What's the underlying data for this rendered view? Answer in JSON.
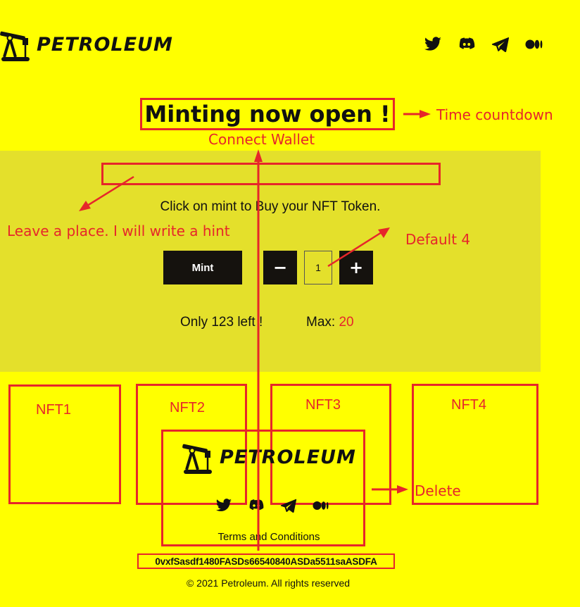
{
  "brand": {
    "name": "PETROLEUM"
  },
  "header": {
    "social_icons": [
      "twitter-icon",
      "discord-icon",
      "telegram-icon",
      "medium-icon"
    ]
  },
  "hero": {
    "title": "Minting now open !"
  },
  "annotations": {
    "time_countdown": "Time countdown",
    "connect_wallet": "Connect Wallet",
    "hint_note": "Leave a place. I will write a hint",
    "default_note": "Default 4",
    "delete_note": "Delete"
  },
  "mint_panel": {
    "instruction": "Click on mint to Buy your NFT Token.",
    "mint_label": "Mint",
    "decrement_label": "−",
    "increment_label": "+",
    "quantity": "1",
    "remaining": "Only 123 left !",
    "max_label": "Max:",
    "max_value": "20"
  },
  "nfts": [
    "NFT1",
    "NFT2",
    "NFT3",
    "NFT4"
  ],
  "footer": {
    "terms": "Terms and Conditions",
    "wallet_address": "0vxfSasdf1480FASDs66540840ASDa5511saASDFA",
    "copyright": "© 2021 Petroleum. All rights reserved"
  },
  "colors": {
    "background": "#ffff00",
    "panel": "#e4e02b",
    "annotation": "#e6262a",
    "button": "#15120e"
  }
}
